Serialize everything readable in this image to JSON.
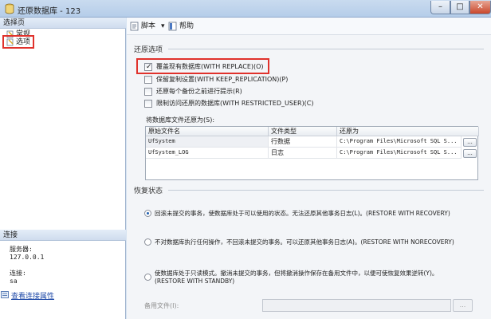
{
  "window": {
    "title": "还原数据库 - 123",
    "min_glyph": "–",
    "max_glyph": "□",
    "close_glyph": "✕"
  },
  "left_panel": {
    "pages_header": "选择页",
    "pages": [
      {
        "label": "常规",
        "icon": "page-icon"
      },
      {
        "label": "选项",
        "icon": "page-icon"
      }
    ],
    "connection_header": "连接",
    "server_label": "服务器:",
    "server_value": "127.0.0.1",
    "login_label": "连接:",
    "login_value": "sa",
    "view_connection_link": "查看连接属性"
  },
  "toolbar": {
    "script_label": "脚本",
    "script_dropdown_glyph": "▾",
    "help_label": "帮助"
  },
  "restore_options": {
    "title": "还原选项",
    "checkboxes": [
      {
        "label": "覆盖现有数据库(WITH REPLACE)(O)",
        "checked": true
      },
      {
        "label": "保留复制设置(WITH KEEP_REPLICATION)(P)",
        "checked": false
      },
      {
        "label": "还原每个备份之前进行提示(R)",
        "checked": false
      },
      {
        "label": "限制访问还原的数据库(WITH RESTRICTED_USER)(C)",
        "checked": false
      }
    ],
    "files_label": "将数据库文件还原为(S):",
    "file_grid": {
      "headers": [
        "原始文件名",
        "文件类型",
        "还原为"
      ],
      "rows": [
        {
          "original": "UfSystem",
          "type": "行数据",
          "restore_as": "C:\\Program Files\\Microsoft SQL S..."
        },
        {
          "original": "UfSystem_LOG",
          "type": "日志",
          "restore_as": "C:\\Program Files\\Microsoft SQL S..."
        }
      ],
      "browse_glyph": "..."
    }
  },
  "recovery_state": {
    "title": "恢复状态",
    "options": [
      {
        "label": "回滚未提交的事务，使数据库处于可以使用的状态。无法还原其他事务日志(L)。(RESTORE WITH RECOVERY)",
        "selected": true
      },
      {
        "label": "不对数据库执行任何操作，不回滚未提交的事务。可以还原其他事务日志(A)。(RESTORE WITH NORECOVERY)",
        "selected": false
      },
      {
        "label_line1": "使数据库处于只读模式。撤消未提交的事务，但将撤消操作保存在备用文件中，以便可使恢复效果逆转(Y)。",
        "label_line2": "(RESTORE WITH STANDBY)",
        "selected": false
      }
    ],
    "standby_file_label": "备用文件(I):",
    "standby_file_value": "",
    "standby_browse_glyph": "..."
  }
}
